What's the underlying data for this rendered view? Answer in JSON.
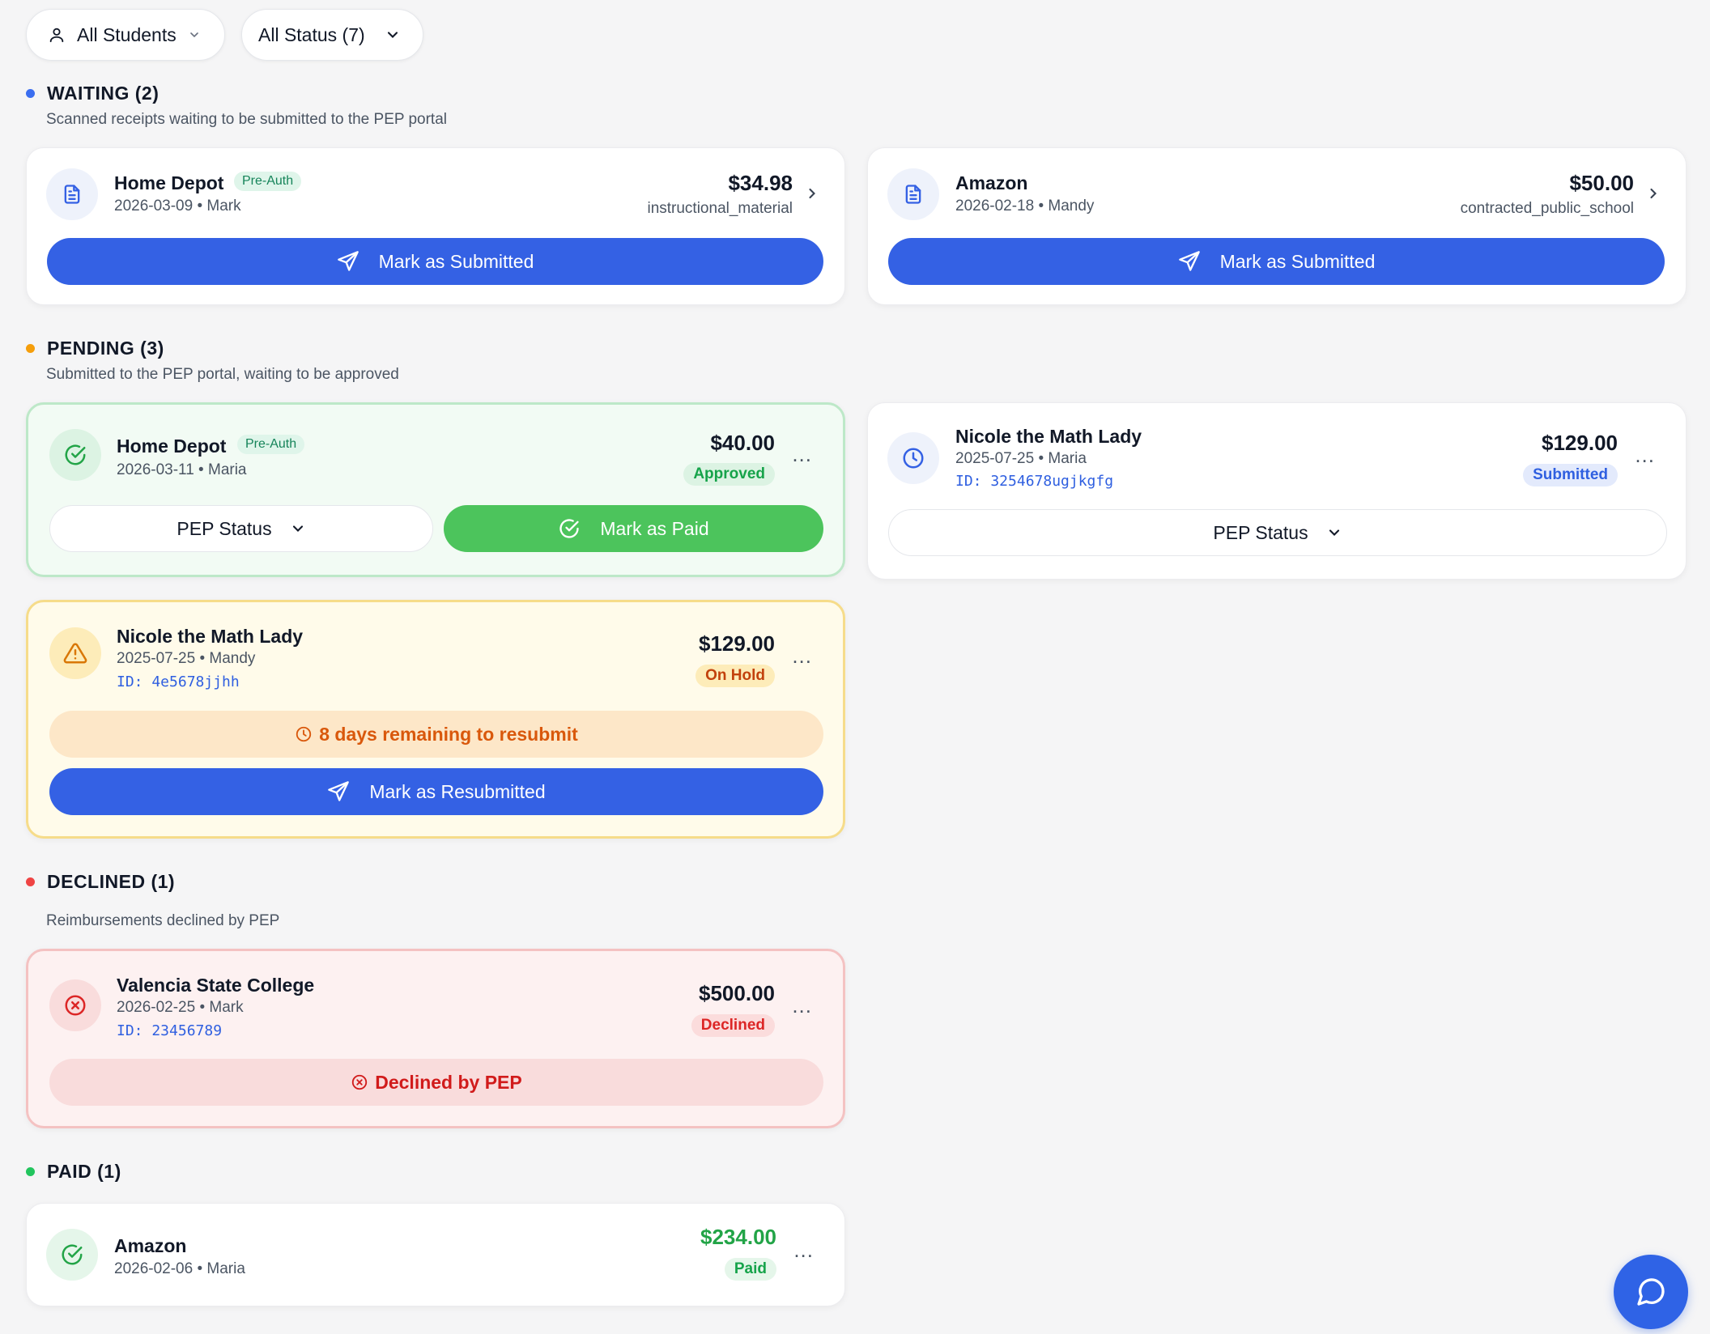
{
  "filters": {
    "students_label": "All Students",
    "status_label": "All Status (7)"
  },
  "colors": {
    "waiting": "#3b6ef0",
    "pending": "#f59e0b",
    "declined": "#ef4444",
    "paid": "#22c55e",
    "primary": "#3461e4"
  },
  "sections": {
    "waiting": {
      "title": "WAITING (2)",
      "subtitle": "Scanned receipts waiting to be submitted to the PEP portal"
    },
    "pending": {
      "title": "PENDING (3)",
      "subtitle": "Submitted to the PEP portal, waiting to be approved"
    },
    "declined": {
      "title": "DECLINED (1)",
      "subtitle": "Reimbursements declined by PEP"
    },
    "paid": {
      "title": "PAID (1)"
    }
  },
  "waiting_cards": [
    {
      "merchant": "Home Depot",
      "badge": "Pre-Auth",
      "meta": "2026-03-09 • Mark",
      "amount": "$34.98",
      "category": "instructional_material",
      "action": "Mark as Submitted"
    },
    {
      "merchant": "Amazon",
      "meta": "2026-02-18 • Mandy",
      "amount": "$50.00",
      "category": "contracted_public_school",
      "action": "Mark as Submitted"
    }
  ],
  "pending_cards": [
    {
      "merchant": "Home Depot",
      "badge": "Pre-Auth",
      "meta": "2026-03-11 • Maria",
      "amount": "$40.00",
      "status": "Approved",
      "status_select": "PEP Status",
      "action": "Mark as Paid"
    },
    {
      "merchant": "Nicole the Math Lady",
      "meta": "2025-07-25 • Maria",
      "id": "ID: 3254678ugjkgfg",
      "amount": "$129.00",
      "status": "Submitted",
      "status_select": "PEP Status"
    },
    {
      "merchant": "Nicole the Math Lady",
      "meta": "2025-07-25 • Mandy",
      "id": "ID: 4e5678jjhh",
      "amount": "$129.00",
      "status": "On Hold",
      "notice": "8 days remaining to resubmit",
      "action": "Mark as Resubmitted"
    }
  ],
  "declined_cards": [
    {
      "merchant": "Valencia State College",
      "meta": "2026-02-25 • Mark",
      "id": "ID: 23456789",
      "amount": "$500.00",
      "status": "Declined",
      "notice": "Declined by PEP"
    }
  ],
  "paid_cards": [
    {
      "merchant": "Amazon",
      "meta": "2026-02-06 • Maria",
      "amount": "$234.00",
      "status": "Paid"
    }
  ],
  "more_menu": "..."
}
